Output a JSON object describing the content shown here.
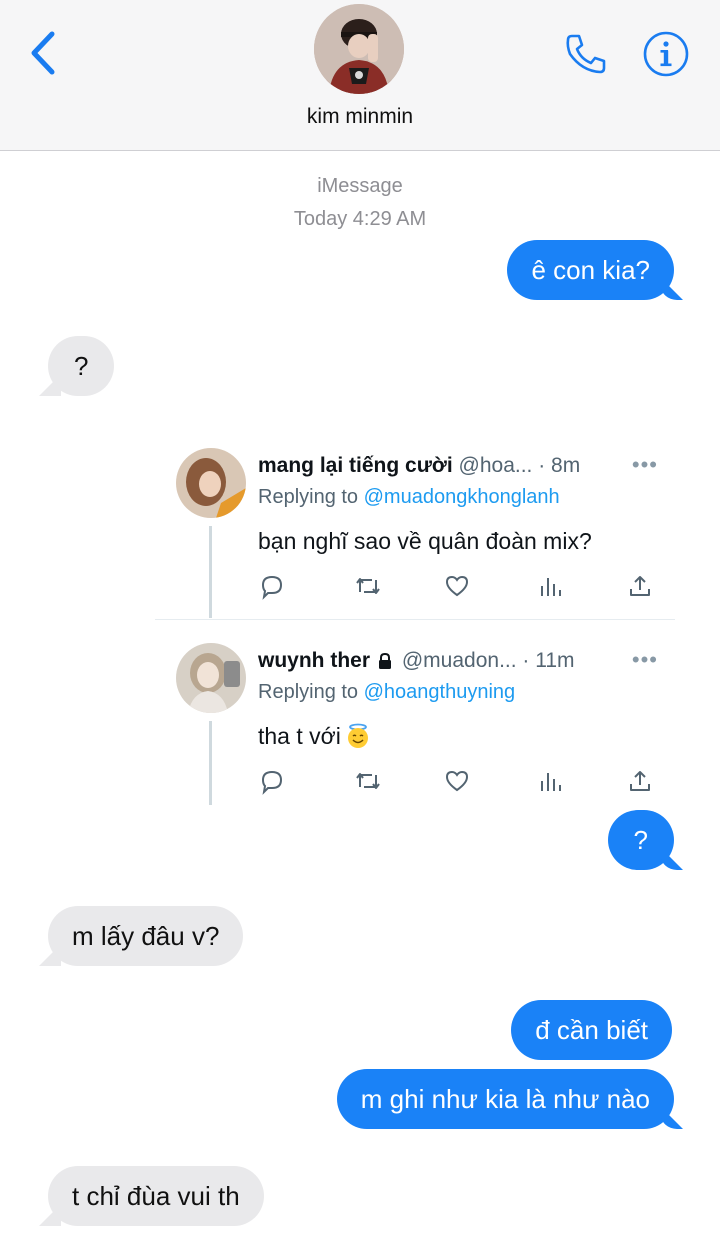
{
  "header": {
    "contact_name": "kim minmin"
  },
  "meta": {
    "service": "iMessage",
    "timestamp": "Today 4:29 AM"
  },
  "messages": [
    {
      "text": "ê con kia?",
      "direction": "outgoing"
    },
    {
      "text": "?",
      "direction": "incoming"
    },
    {
      "text": "?",
      "direction": "outgoing"
    },
    {
      "text": "m lấy đâu v?",
      "direction": "incoming"
    },
    {
      "text": "đ cần biết",
      "direction": "outgoing"
    },
    {
      "text": "m ghi như kia là như nào",
      "direction": "outgoing"
    },
    {
      "text": "t chỉ đùa vui th",
      "direction": "incoming"
    }
  ],
  "tweets": [
    {
      "name": "mang lại tiếng cười",
      "handle": "@hoa...",
      "time": "· 8m",
      "replying_prefix": "Replying to ",
      "replying_to": "@muadongkhonglanh",
      "text": "bạn nghĩ sao về quân đoàn mix?",
      "more": "•••"
    },
    {
      "name": "wuynh ther",
      "handle": "@muadon...",
      "time": "· 11m",
      "replying_prefix": "Replying to ",
      "replying_to": "@hoangthuyning",
      "text": "tha t với",
      "more": "•••"
    }
  ],
  "colors": {
    "outgoing_bubble": "#1a82f7",
    "incoming_bubble": "#e9e9eb",
    "ios_blue": "#1a7cf0",
    "twitter_blue": "#1d9bf0"
  },
  "icons": [
    "back-chevron-icon",
    "phone-icon",
    "info-icon",
    "reply-icon",
    "retweet-icon",
    "like-icon",
    "stats-icon",
    "share-icon",
    "lock-icon",
    "smiling-face-with-halo-icon"
  ]
}
